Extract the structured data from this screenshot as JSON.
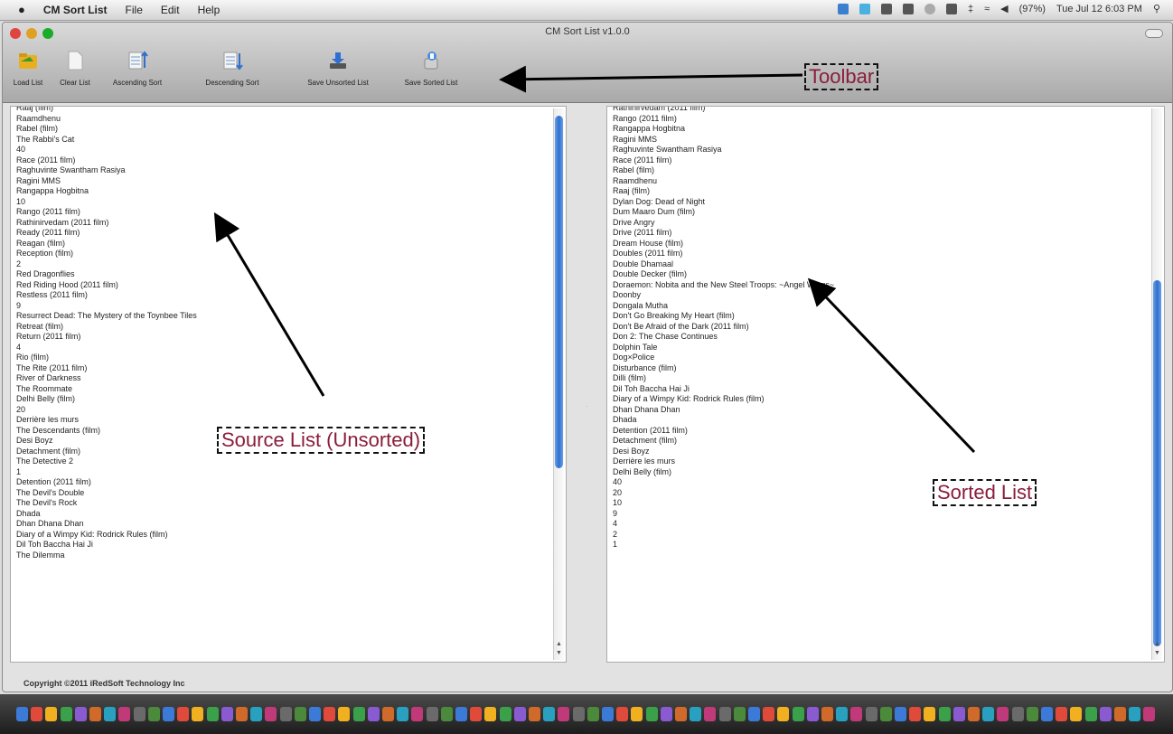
{
  "menubar": {
    "app_name": "CM Sort List",
    "menus": [
      "File",
      "Edit",
      "Help"
    ],
    "battery": "(97%)",
    "datetime": "Tue Jul 12  6:03 PM"
  },
  "window": {
    "title": "CM Sort List v1.0.0"
  },
  "toolbar": {
    "buttons": [
      {
        "label": "Load List",
        "icon": "folder-open-icon"
      },
      {
        "label": "Clear List",
        "icon": "blank-document-icon"
      },
      {
        "label": "Ascending Sort",
        "icon": "ascending-sort-icon"
      },
      {
        "label": "Descending Sort",
        "icon": "descending-sort-icon"
      },
      {
        "label": "Save Unsorted List",
        "icon": "download-save-icon"
      },
      {
        "label": "Save Sorted List",
        "icon": "sorted-save-icon"
      }
    ]
  },
  "source_list": [
    "Raaj (film)",
    "Raamdhenu",
    "Rabel (film)",
    "The Rabbi's Cat",
    "40",
    "Race (2011 film)",
    "Raghuvinte Swantham Rasiya",
    "Ragini MMS",
    "Rangappa Hogbitna",
    "10",
    "Rango (2011 film)",
    "Rathinirvedam (2011 film)",
    "Ready (2011 film)",
    "Reagan (film)",
    "Reception (film)",
    "2",
    "Red Dragonflies",
    "Red Riding Hood (2011 film)",
    "Restless (2011 film)",
    "9",
    "Resurrect Dead: The Mystery of the Toynbee Tiles",
    "Retreat (film)",
    "Return (2011 film)",
    "4",
    "Rio (film)",
    "The Rite (2011 film)",
    "River of Darkness",
    "The Roommate",
    "Delhi Belly (film)",
    "20",
    "Derrière les murs",
    "The Descendants (film)",
    "Desi Boyz",
    "Detachment (film)",
    "The Detective 2",
    "1",
    "Detention (2011 film)",
    "The Devil's Double",
    "The Devil's Rock",
    "Dhada",
    "Dhan Dhana Dhan",
    "Diary of a Wimpy Kid: Rodrick Rules (film)",
    "Dil Toh Baccha Hai Ji",
    "The Dilemma"
  ],
  "sorted_list": [
    "Rathinirvedam (2011 film)",
    "Rango (2011 film)",
    "Rangappa Hogbitna",
    "Ragini MMS",
    "Raghuvinte Swantham Rasiya",
    "Race (2011 film)",
    "Rabel (film)",
    "Raamdhenu",
    "Raaj (film)",
    "Dylan Dog: Dead of Night",
    "Dum Maaro Dum (film)",
    "Drive Angry",
    "Drive (2011 film)",
    "Dream House (film)",
    "Doubles (2011 film)",
    "Double Dhamaal",
    "Double Decker (film)",
    "Doraemon: Nobita and the New Steel Troops: ~Angel Wings~",
    "Doonby",
    "Dongala Mutha",
    "Don't Go Breaking My Heart (film)",
    "Don't Be Afraid of the Dark (2011 film)",
    "Don 2: The Chase Continues",
    "Dolphin Tale",
    "Dog×Police",
    "Disturbance (film)",
    "Dilli (film)",
    "Dil Toh Baccha Hai Ji",
    "Diary of a Wimpy Kid: Rodrick Rules (film)",
    "Dhan Dhana Dhan",
    "Dhada",
    "Detention (2011 film)",
    "Detachment (film)",
    "Desi Boyz",
    "Derrière les murs",
    "Delhi Belly (film)",
    "40",
    "20",
    "10",
    "9",
    "4",
    "2",
    "1"
  ],
  "footer": {
    "copyright": "Copyright ©2011 iRedSoft Technology Inc"
  },
  "annotations": {
    "toolbar": "Toolbar",
    "source": "Source List (Unsorted)",
    "sorted": "Sorted List"
  },
  "colors": {
    "annotation_text": "#8a1d3a",
    "scroll_thumb": "#2f6fd0"
  }
}
